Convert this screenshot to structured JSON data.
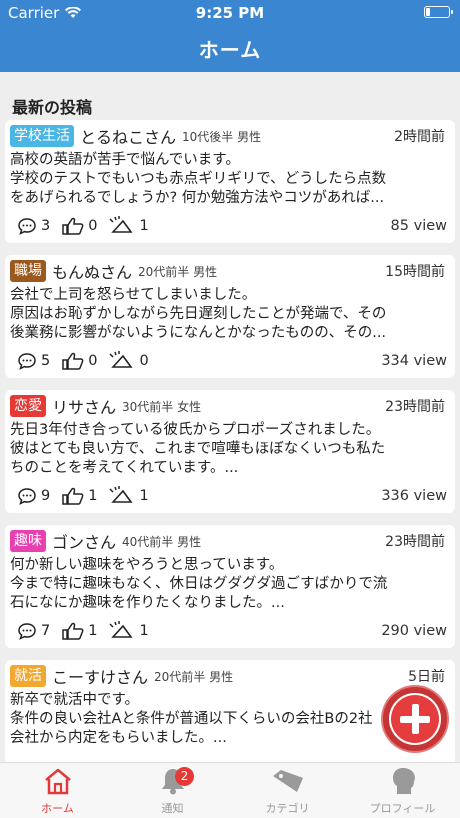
{
  "status_bar": {
    "carrier": "Carrier",
    "time": "9:25 PM"
  },
  "nav": {
    "title": "ホーム"
  },
  "section_title": "最新の投稿",
  "posts": [
    {
      "category": "学校生活",
      "category_color": "#4ab6e6",
      "username": "とるねこさん",
      "userinfo": "10代後半 男性",
      "ago": "2時間前",
      "lines": [
        "高校の英語が苦手で悩んでいます。",
        "学校のテストでもいつも赤点ギリギリで、どうしたら点数",
        "をあげられるでしょうか? 何か勉強方法やコツがあれば..."
      ],
      "comments": "3",
      "likes": "0",
      "dislikes": "1",
      "views": "85 view"
    },
    {
      "category": "職場",
      "category_color": "#9a5a1f",
      "username": "もんぬさん",
      "userinfo": "20代前半 男性",
      "ago": "15時間前",
      "lines": [
        "会社で上司を怒らせてしまいました。",
        "原因はお恥ずかしながら先日遅刻したことが発端で、その",
        "後業務に影響がないようになんとかなったものの、その..."
      ],
      "comments": "5",
      "likes": "0",
      "dislikes": "0",
      "views": "334 view"
    },
    {
      "category": "恋愛",
      "category_color": "#e53935",
      "username": "リサさん",
      "userinfo": "30代前半 女性",
      "ago": "23時間前",
      "lines": [
        "先日3年付き合っている彼氏からプロポーズされました。",
        "彼はとても良い方で、これまで喧嘩もほぼなくいつも私た",
        "ちのことを考えてくれています。..."
      ],
      "comments": "9",
      "likes": "1",
      "dislikes": "1",
      "views": "336 view"
    },
    {
      "category": "趣味",
      "category_color": "#e83fb1",
      "username": "ゴンさん",
      "userinfo": "40代前半 男性",
      "ago": "23時間前",
      "lines": [
        "何か新しい趣味をやろうと思っています。",
        "今まで特に趣味もなく、休日はグダグダ過ごすばかりで流",
        "石になにか趣味を作りたくなりました。..."
      ],
      "comments": "7",
      "likes": "1",
      "dislikes": "1",
      "views": "290 view"
    },
    {
      "category": "就活",
      "category_color": "#f0a830",
      "username": "こーすけさん",
      "userinfo": "20代前半 男性",
      "ago": "5日前",
      "lines": [
        "新卒で就活中です。",
        "条件の良い会社Aと条件が普通以下くらいの会社Bの2社",
        "会社から内定をもらいました。..."
      ],
      "comments": "",
      "likes": "",
      "dislikes": "",
      "views": ""
    }
  ],
  "fab": {
    "icon": "plus-icon",
    "color": "#e53d3d"
  },
  "tabbar": {
    "tabs": [
      {
        "label": "ホーム",
        "icon": "home-icon"
      },
      {
        "label": "通知",
        "icon": "bell-icon",
        "badge": "2"
      },
      {
        "label": "カテゴリ",
        "icon": "tag-icon"
      },
      {
        "label": "プロフィール",
        "icon": "profile-icon"
      }
    ]
  }
}
